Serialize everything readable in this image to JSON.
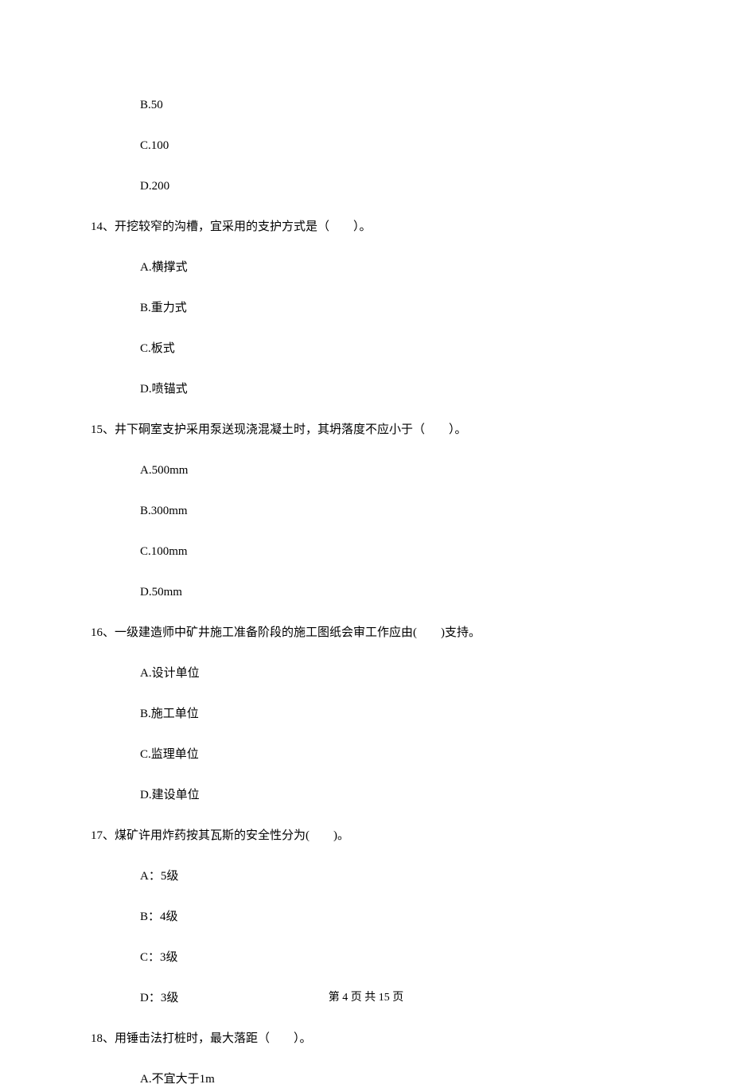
{
  "q13_options": {
    "b": "B.50",
    "c": "C.100",
    "d": "D.200"
  },
  "q14": {
    "stem": "14、开挖较窄的沟槽，宜采用的支护方式是（　　）。",
    "a": "A.横撑式",
    "b": "B.重力式",
    "c": "C.板式",
    "d": "D.喷锚式"
  },
  "q15": {
    "stem": "15、井下硐室支护采用泵送现浇混凝土时，其坍落度不应小于（　　）。",
    "a": "A.500mm",
    "b": "B.300mm",
    "c": "C.100mm",
    "d": "D.50mm"
  },
  "q16": {
    "stem": "16、一级建造师中矿井施工准备阶段的施工图纸会审工作应由(　　)支持。",
    "a": "A.设计单位",
    "b": "B.施工单位",
    "c": "C.监理单位",
    "d": "D.建设单位"
  },
  "q17": {
    "stem": "17、煤矿许用炸药按其瓦斯的安全性分为(　　)。",
    "a": "A：5级",
    "b": "B：4级",
    "c": "C：3级",
    "d": "D：3级"
  },
  "q18": {
    "stem": "18、用锤击法打桩时，最大落距（　　）。",
    "a": "A.不宜大于1m"
  },
  "footer": "第 4 页 共 15 页"
}
